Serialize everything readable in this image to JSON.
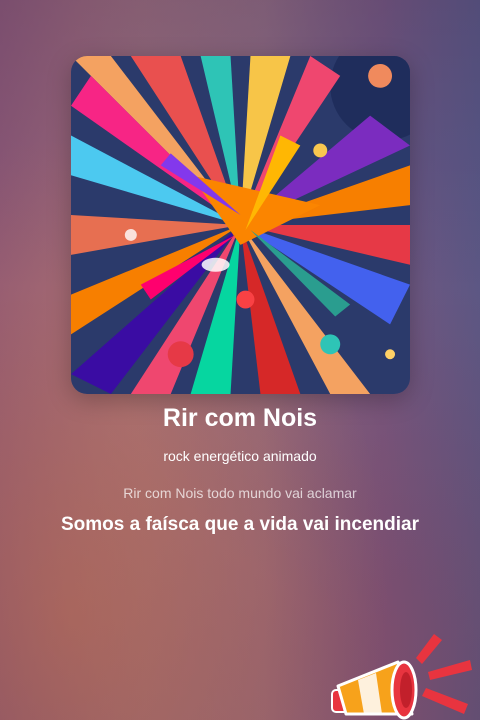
{
  "song": {
    "title": "Rir com Nois",
    "genre": "rock energético animado"
  },
  "lyrics": {
    "previous": "Rir com Nois todo mundo vai aclamar",
    "current": "Somos a faísca que a vida vai incendiar"
  },
  "icons": {
    "promo": "megaphone-icon"
  },
  "colors": {
    "text": "#ffffff",
    "lyric_dim": "rgba(255,255,255,0.72)",
    "megaphone_accent": "#e8343f",
    "megaphone_cone": "#f7a21b"
  }
}
